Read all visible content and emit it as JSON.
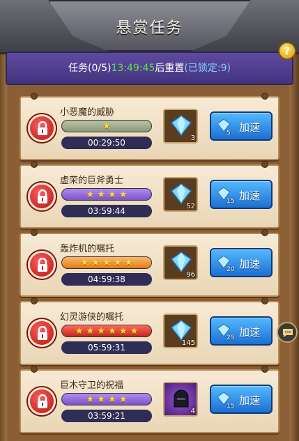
{
  "header": {
    "title": "悬赏任务"
  },
  "help": {
    "label": "?"
  },
  "banner": {
    "part1": "任务(0/5)",
    "part2": "13:49:45",
    "part3": "后重置",
    "part4": "(已锁定:9)"
  },
  "tasks": [
    {
      "name": "小恶魔的威胁",
      "stars": "★",
      "star_count": 1,
      "star_color": "grey",
      "timer": "00:29:50",
      "reward_type": "gem",
      "reward_count": "3",
      "speed_cost": "5",
      "speed_label": "加速"
    },
    {
      "name": "虚荣的巨斧勇士",
      "stars": "★ ★ ★ ★",
      "star_count": 4,
      "star_color": "purple",
      "timer": "03:59:44",
      "reward_type": "gem",
      "reward_count": "52",
      "speed_cost": "15",
      "speed_label": "加速"
    },
    {
      "name": "轰炸机的嘱托",
      "stars": "★ ★ ★ ★ ★",
      "star_count": 5,
      "star_color": "orange",
      "timer": "04:59:38",
      "reward_type": "gem",
      "reward_count": "96",
      "speed_cost": "20",
      "speed_label": "加速"
    },
    {
      "name": "幻灵游侠的嘱托",
      "stars": "★ ★ ★ ★ ★ ★",
      "star_count": 6,
      "star_color": "red",
      "timer": "05:59:31",
      "reward_type": "gem",
      "reward_count": "145",
      "speed_cost": "25",
      "speed_label": "加速"
    },
    {
      "name": "巨木守卫的祝福",
      "stars": "★ ★ ★ ★",
      "star_count": 4,
      "star_color": "purple",
      "timer": "03:59:21",
      "reward_type": "hero",
      "reward_count": "4",
      "speed_cost": "15",
      "speed_label": "加速"
    }
  ],
  "colors": {
    "timer_highlight": "#5ee04a",
    "locked_text": "#7fd2ff",
    "banner_bg": "#4f3d8e"
  }
}
